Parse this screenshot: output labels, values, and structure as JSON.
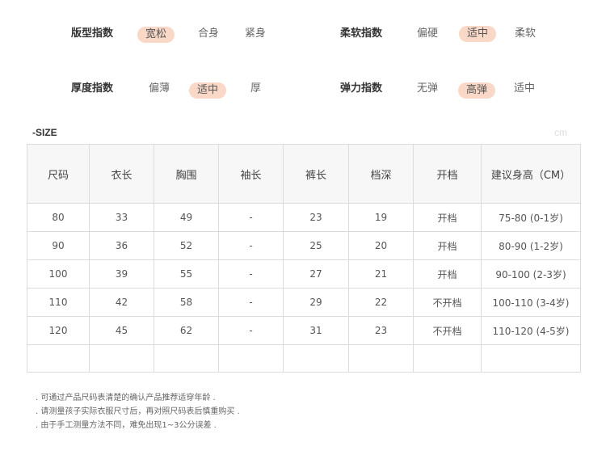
{
  "attributes": {
    "fit": {
      "label": "版型指数",
      "options": [
        "宽松",
        "合身",
        "紧身"
      ],
      "selected": "宽松"
    },
    "softness": {
      "label": "柔软指数",
      "options": [
        "偏硬",
        "适中",
        "柔软"
      ],
      "selected": "适中"
    },
    "thickness": {
      "label": "厚度指数",
      "options": [
        "偏薄",
        "适中",
        "厚"
      ],
      "selected": "适中"
    },
    "elasticity": {
      "label": "弹力指数",
      "options": [
        "无弹",
        "高弹",
        "适中"
      ],
      "selected": "高弹"
    }
  },
  "size_table": {
    "title": "-SIZE",
    "unit": "cm",
    "headers": [
      "尺码",
      "衣长",
      "胸围",
      "袖长",
      "裤长",
      "档深",
      "开档",
      "建议身高（CM）"
    ],
    "rows": [
      [
        "80",
        "33",
        "49",
        "-",
        "23",
        "19",
        "开档",
        "75-80 (0-1岁)"
      ],
      [
        "90",
        "36",
        "52",
        "-",
        "25",
        "20",
        "开档",
        "80-90 (1-2岁)"
      ],
      [
        "100",
        "39",
        "55",
        "-",
        "27",
        "21",
        "开档",
        "90-100 (2-3岁)"
      ],
      [
        "110",
        "42",
        "58",
        "-",
        "29",
        "22",
        "不开档",
        "100-110 (3-4岁)"
      ],
      [
        "120",
        "45",
        "62",
        "-",
        "31",
        "23",
        "不开档",
        "110-120 (4-5岁)"
      ]
    ]
  },
  "notes": [
    ". 可通过产品尺码表清楚的确认产品推荐适穿年龄 .",
    ". 请测量孩子实际衣服尺寸后，再对照尺码表后慎重购买 .",
    ". 由于手工测量方法不同，难免出现1~3公分误差 ."
  ],
  "colors": {
    "selected_bg": "#f9d8c8",
    "table_border": "#dcdcdc",
    "header_bg": "#f7f7f7"
  }
}
